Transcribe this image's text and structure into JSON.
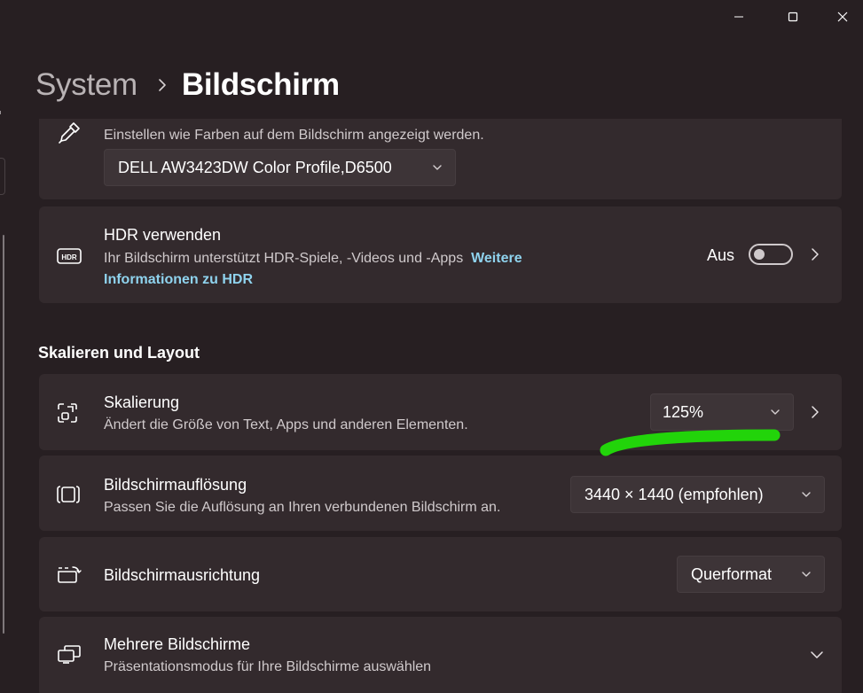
{
  "window": {
    "minimize_icon": "minimize-icon",
    "maximize_icon": "maximize-icon",
    "close_icon": "close-icon"
  },
  "breadcrumb": {
    "parent": "System",
    "separator_icon": "chevron-right-icon",
    "current": "Bildschirm"
  },
  "color_profile": {
    "icon": "eyedropper-icon",
    "description": "Einstellen wie Farben auf dem Bildschirm angezeigt werden.",
    "selected": "DELL AW3423DW Color Profile,D6500"
  },
  "hdr": {
    "icon": "hdr-icon",
    "title": "HDR verwenden",
    "description": "Ihr Bildschirm unterstützt HDR-Spiele, -Videos und -Apps",
    "link": "Weitere Informationen zu HDR",
    "toggle_label": "Aus",
    "toggle_on": false
  },
  "section": {
    "title": "Skalieren und Layout"
  },
  "scaling": {
    "icon": "scale-icon",
    "title": "Skalierung",
    "description": "Ändert die Größe von Text, Apps und anderen Elementen.",
    "selected": "125%"
  },
  "resolution": {
    "icon": "resolution-icon",
    "title": "Bildschirmauflösung",
    "description": "Passen Sie die Auflösung an Ihren verbundenen Bildschirm an.",
    "selected": "3440 × 1440 (empfohlen)"
  },
  "orientation": {
    "icon": "orientation-icon",
    "title": "Bildschirmausrichtung",
    "selected": "Querformat"
  },
  "multi_display": {
    "icon": "multiple-displays-icon",
    "title": "Mehrere Bildschirme",
    "description": "Präsentationsmodus für Ihre Bildschirme auswählen"
  },
  "colors": {
    "background": "#271f22",
    "card": "#332a2d",
    "accent_link": "#8fd3ee",
    "annotation": "#22d40a"
  }
}
